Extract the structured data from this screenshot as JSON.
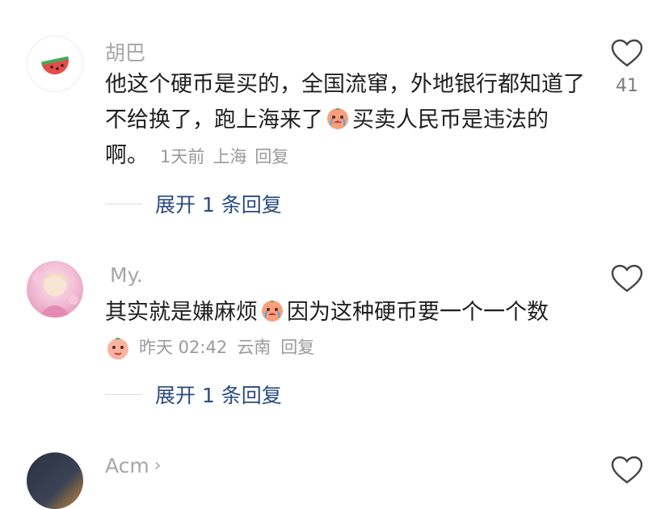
{
  "comments": [
    {
      "username": "胡巴",
      "text_part1": "他这个硬币是买的，全国流窜，外地银行都知道了不给换了，跑上海来了",
      "text_part2": "买卖人民币是违法的啊。",
      "time": "1天前",
      "location": "上海",
      "reply_label": "回复",
      "likes": "41",
      "expand_label": "展开 1 条回复",
      "avatar_icon": "watermelon-icon"
    },
    {
      "username": "My.",
      "text_part1": "其实就是嫌麻烦",
      "text_part2": "因为这种硬币要一个一个数",
      "time": "昨天 02:42",
      "location": "云南",
      "reply_label": "回复",
      "expand_label": "展开 1 条回复",
      "avatar_icon": "anime-avatar"
    },
    {
      "username": "Acm",
      "chevron": "›"
    }
  ],
  "colors": {
    "link": "#2b4a80",
    "meta": "#9a9a9a",
    "text": "#1f1f1f"
  }
}
